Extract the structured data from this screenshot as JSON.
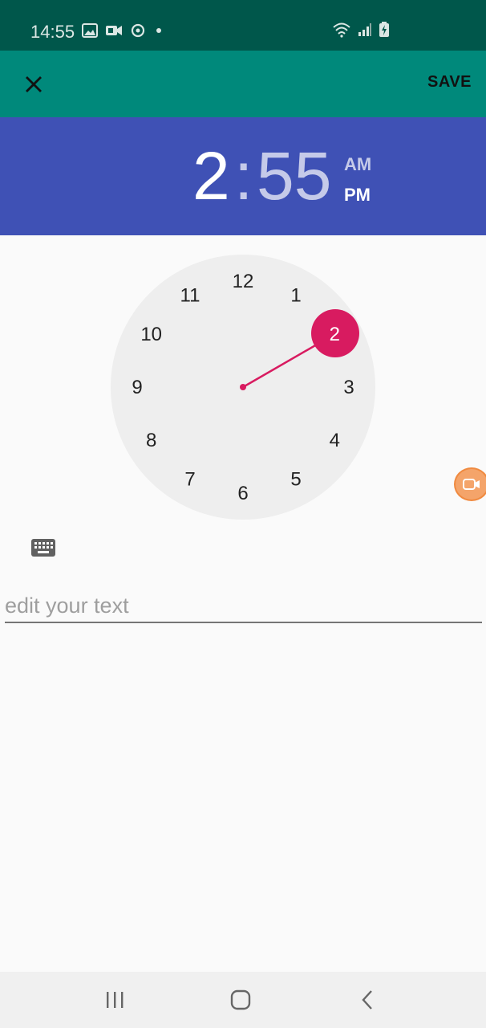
{
  "status_bar": {
    "time": "14:55",
    "left_icons": [
      "image-icon",
      "video-icon",
      "sync-icon",
      "dot-icon"
    ],
    "right_icons": [
      "wifi-icon",
      "signal-icon",
      "battery-charging-icon"
    ]
  },
  "toolbar": {
    "close_icon": "close-icon",
    "save_label": "SAVE"
  },
  "time_header": {
    "hour": "2",
    "colon": ":",
    "minute": "55",
    "am_label": "AM",
    "pm_label": "PM",
    "selected_period": "PM"
  },
  "clock": {
    "numbers": [
      "12",
      "1",
      "2",
      "3",
      "4",
      "5",
      "6",
      "7",
      "8",
      "9",
      "10",
      "11"
    ],
    "selected_hour": "2",
    "accent_color": "#d81b60"
  },
  "input": {
    "placeholder": "edit your text",
    "value": ""
  },
  "colors": {
    "status_bar": "#00574b",
    "toolbar": "#00897b",
    "header": "#3f51b5",
    "accent": "#d81b60"
  }
}
